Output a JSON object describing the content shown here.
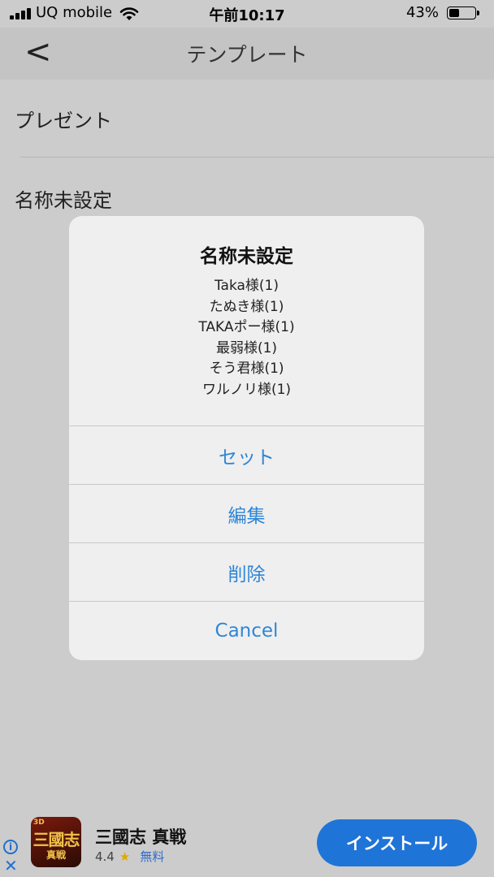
{
  "status_bar": {
    "carrier": "UQ mobile",
    "time": "午前10:17",
    "battery_percent": "43%",
    "battery_level": 0.43
  },
  "nav": {
    "title": "テンプレート",
    "back_label": "<"
  },
  "list": {
    "items": [
      "プレゼント",
      "名称未設定"
    ]
  },
  "sheet": {
    "title": "名称未設定",
    "lines": [
      "Taka様(1)",
      "たぬき様(1)",
      "TAKAポー様(1)",
      "最弱様(1)",
      "そう君様(1)",
      "ワルノリ様(1)"
    ],
    "actions": [
      "セット",
      "編集",
      "削除",
      "Cancel"
    ],
    "action_color": "#2f86d6"
  },
  "ad": {
    "app_name": "三國志 真戦",
    "rating": "4.4",
    "price": "無料",
    "install_label": "インストール",
    "icon_text": "三國志",
    "icon_subtext": "真戦",
    "icon_badge": "3D",
    "button_color": "#1f74d8"
  }
}
